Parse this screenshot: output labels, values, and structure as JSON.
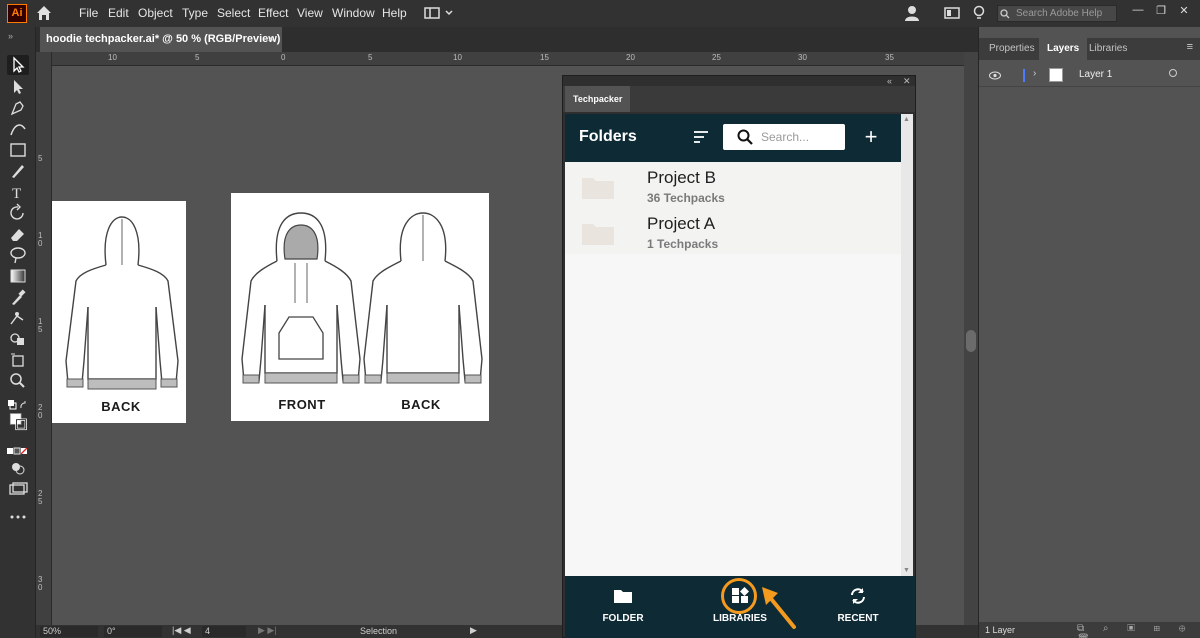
{
  "menubar": {
    "app_logo": "Ai",
    "items": [
      "File",
      "Edit",
      "Object",
      "Type",
      "Select",
      "Effect",
      "View",
      "Window",
      "Help"
    ],
    "search_placeholder": "Search Adobe Help"
  },
  "document_tab": {
    "title": "hoodie techpacker.ai* @ 50 % (RGB/Preview)",
    "close": "×"
  },
  "ruler_top_labels": [
    "10",
    "5",
    "0",
    "5",
    "10",
    "15",
    "20",
    "25",
    "30",
    "35"
  ],
  "ruler_left_labels": [
    "5",
    "1 0",
    "1 5",
    "2 0",
    "2 5",
    "3 0"
  ],
  "artboards": {
    "left_label": "BACK",
    "front_label": "FRONT",
    "back_label": "BACK"
  },
  "techpacker": {
    "tab_label": "Techpacker",
    "header_title": "Folders",
    "search_placeholder": "Search...",
    "add_button": "+",
    "folders": [
      {
        "name": "Project B",
        "count": "36 Techpacks"
      },
      {
        "name": "Project A",
        "count": "1 Techpacks"
      }
    ],
    "nav": [
      {
        "label": "FOLDER",
        "icon": "folder-icon"
      },
      {
        "label": "LIBRARIES",
        "icon": "libraries-icon"
      },
      {
        "label": "RECENT",
        "icon": "refresh-icon"
      }
    ],
    "highlight_color": "#f39a1f",
    "header_color": "#0e2a35"
  },
  "right_panel": {
    "tabs": [
      "Properties",
      "Layers",
      "Libraries"
    ],
    "active_tab": "Layers",
    "layer_name": "Layer 1",
    "footer_count": "1 Layer"
  },
  "statusbar": {
    "zoom": "50%",
    "rotation": "0°",
    "artboard_number": "4",
    "tool": "Selection"
  }
}
